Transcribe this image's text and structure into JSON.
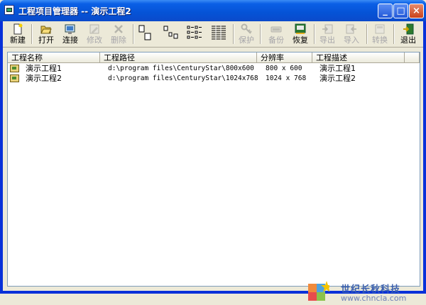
{
  "window": {
    "title": "工程项目管理器 -- 演示工程2"
  },
  "titlebar_buttons": {
    "minimize": "_",
    "maximize": "□",
    "close": "×"
  },
  "toolbar": {
    "items": [
      {
        "label": "新建",
        "icon": "new-file-icon",
        "enabled": true
      },
      {
        "label": "打开",
        "icon": "open-folder-icon",
        "enabled": true
      },
      {
        "label": "连接",
        "icon": "connect-icon",
        "enabled": true
      },
      {
        "label": "修改",
        "icon": "edit-icon",
        "enabled": false
      },
      {
        "label": "删除",
        "icon": "delete-icon",
        "enabled": false
      },
      {
        "label": "保护",
        "icon": "key-icon",
        "enabled": false
      },
      {
        "label": "备份",
        "icon": "backup-icon",
        "enabled": false
      },
      {
        "label": "恢复",
        "icon": "restore-icon",
        "enabled": true
      },
      {
        "label": "导出",
        "icon": "export-icon",
        "enabled": false
      },
      {
        "label": "导入",
        "icon": "import-icon",
        "enabled": false
      },
      {
        "label": "转换",
        "icon": "convert-icon",
        "enabled": false
      },
      {
        "label": "退出",
        "icon": "exit-icon",
        "enabled": true
      }
    ],
    "view_buttons": [
      "large-icons-view-icon",
      "small-icons-view-icon",
      "list-view-icon",
      "details-view-icon"
    ]
  },
  "table": {
    "columns": [
      "工程名称",
      "工程路径",
      "分辨率",
      "工程描述"
    ],
    "rows": [
      [
        "演示工程1",
        "d:\\program files\\CenturyStar\\800x600",
        "800 x 600",
        "演示工程1"
      ],
      [
        "演示工程2",
        "d:\\program files\\CenturyStar\\1024x768",
        "1024 x 768",
        "演示工程2"
      ]
    ]
  },
  "watermark": {
    "name": "世纪长秋科技",
    "url": "www.chncla.com"
  },
  "colors": {
    "titlebar": "#0553D6",
    "window_bg": "#ECE9D8",
    "logo_text": "#3A5FAE"
  }
}
